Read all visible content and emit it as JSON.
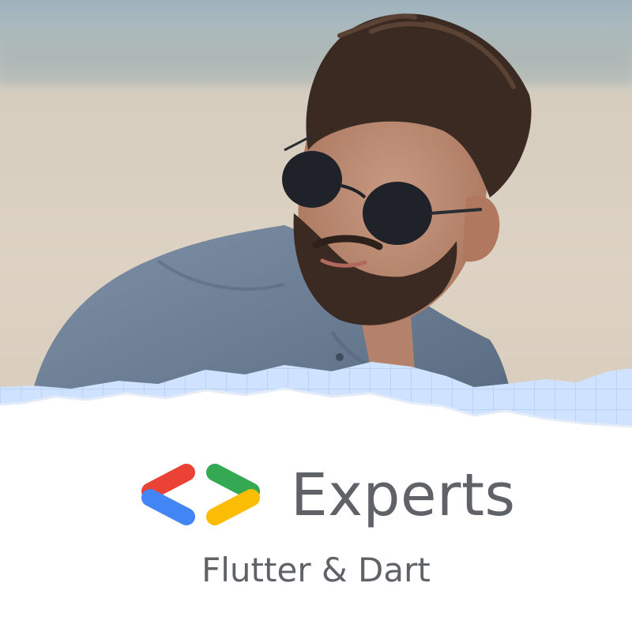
{
  "badge": {
    "program_name": "Experts",
    "specialty": "Flutter & Dart"
  },
  "colors": {
    "logo_red": "#EA4335",
    "logo_blue": "#4285F4",
    "logo_green": "#34A853",
    "logo_yellow": "#FBBC04",
    "text_gray": "#5F6368",
    "paper_blue": "#CFE2FF",
    "grid_line": "#A9C8F5"
  },
  "icons": {
    "logo": "developer-brackets-icon"
  }
}
